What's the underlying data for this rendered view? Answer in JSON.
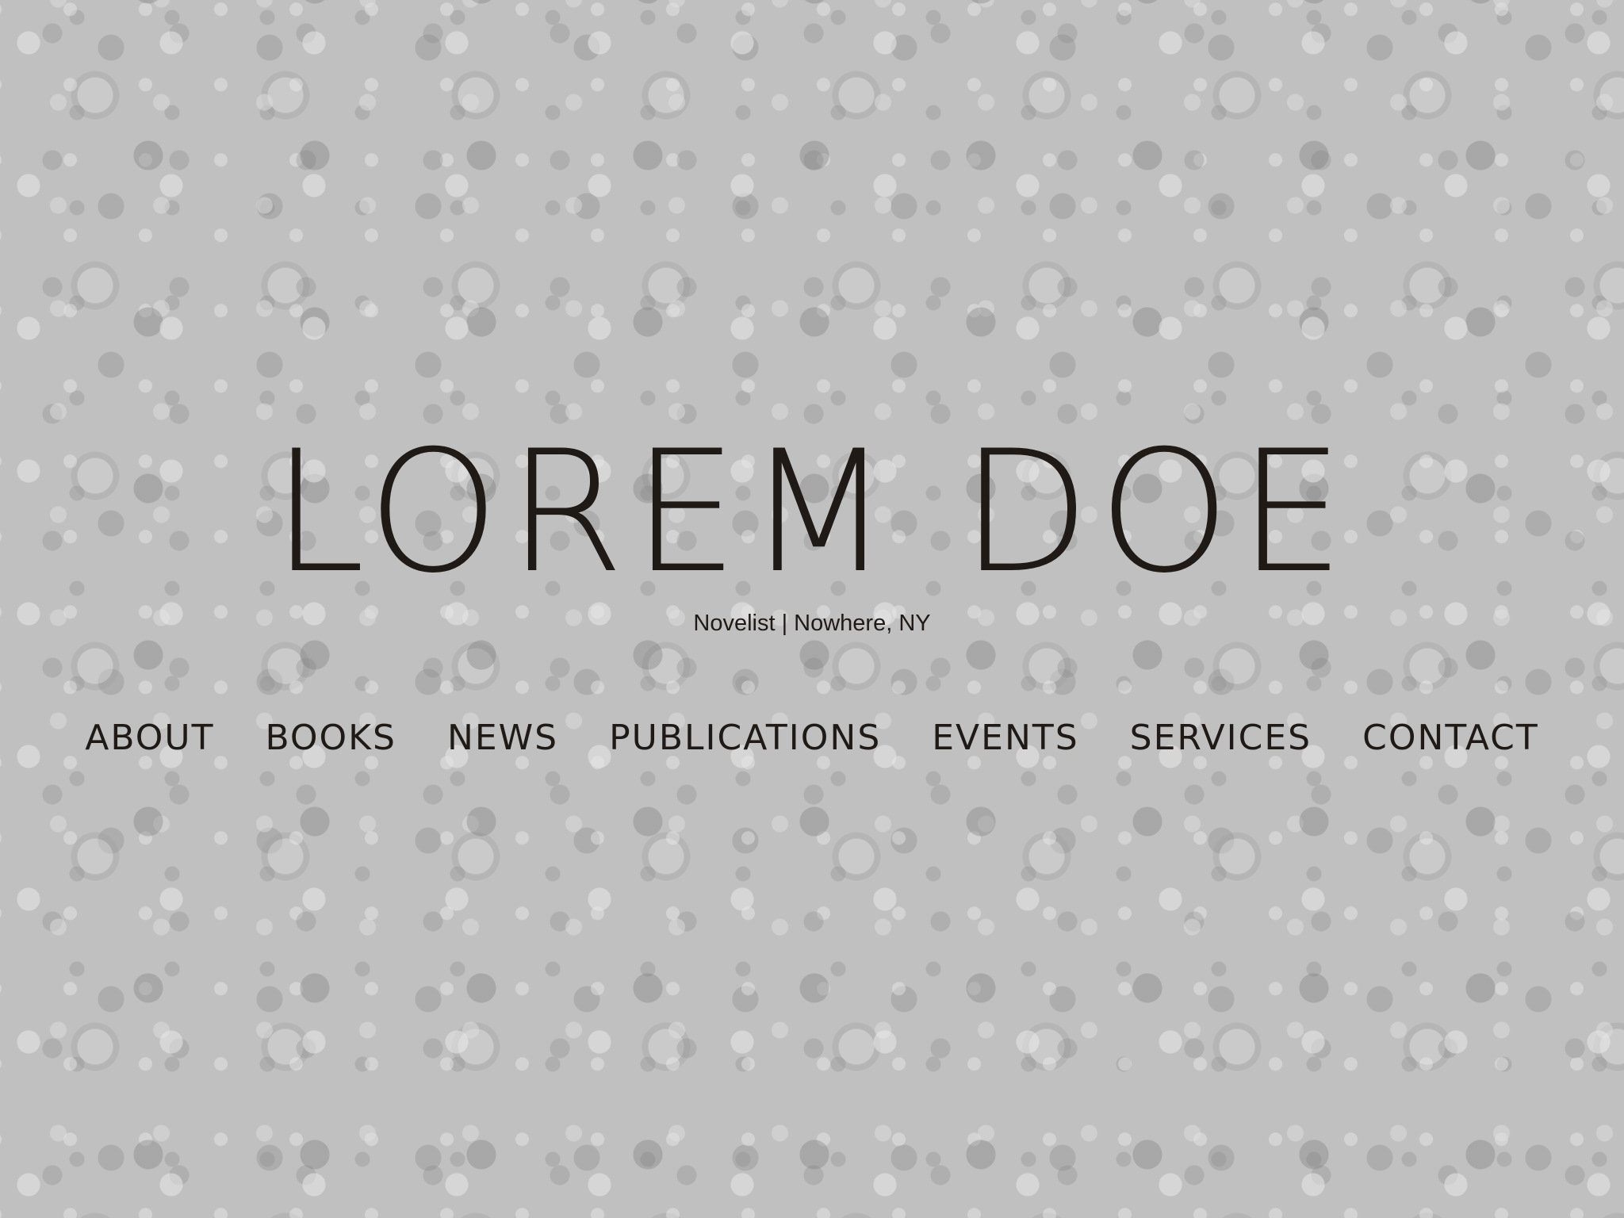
{
  "site": {
    "title": "LOREM DOE",
    "tagline": "Novelist | Nowhere, NY"
  },
  "nav": {
    "items": [
      {
        "label": "ABOUT"
      },
      {
        "label": "BOOKS"
      },
      {
        "label": "NEWS"
      },
      {
        "label": "PUBLICATIONS"
      },
      {
        "label": "EVENTS"
      },
      {
        "label": "SERVICES"
      },
      {
        "label": "CONTACT"
      }
    ]
  },
  "colors": {
    "text": "#201a17",
    "background": "#bdbdbd"
  },
  "background_image": "grayscale-flower-field"
}
